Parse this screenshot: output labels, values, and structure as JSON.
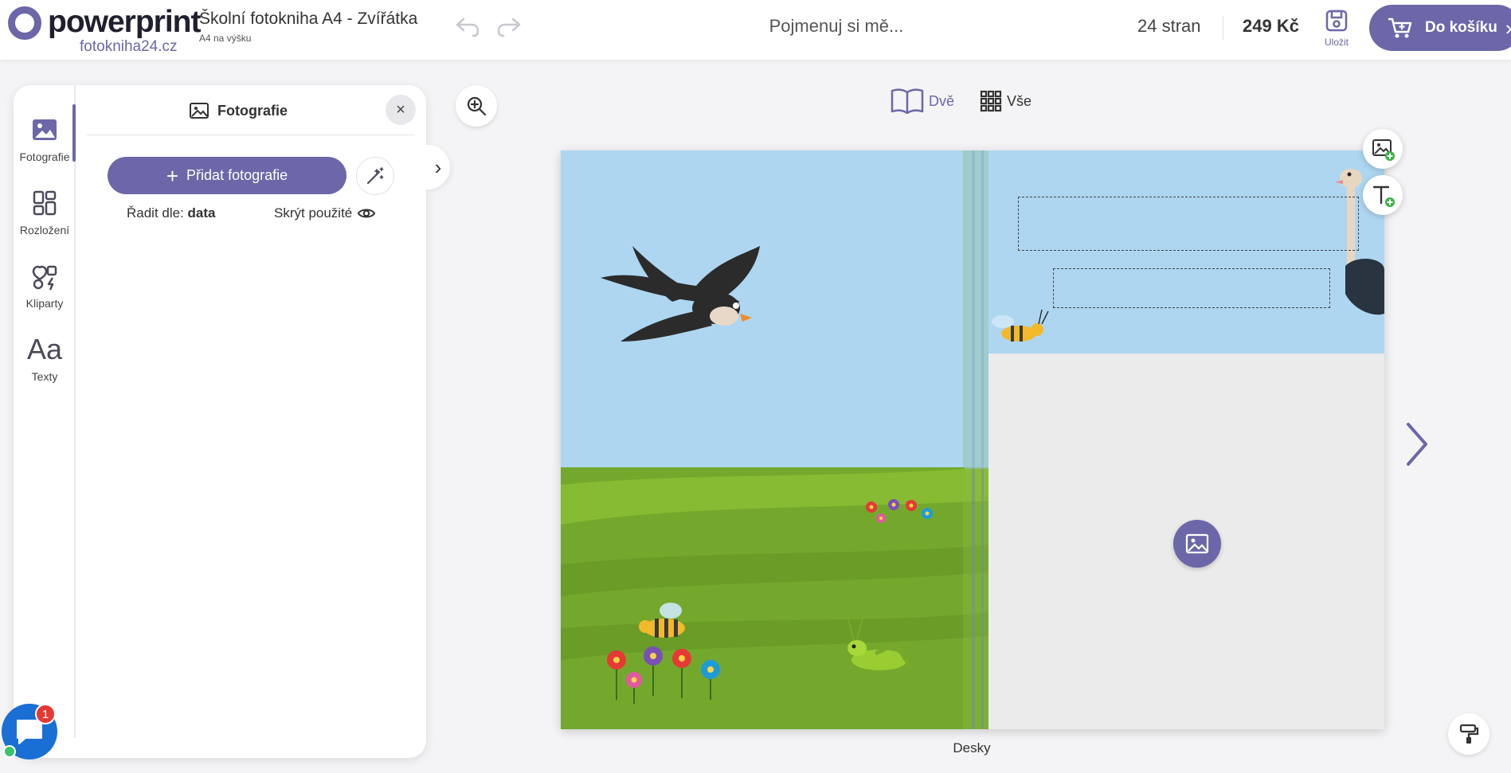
{
  "brand": {
    "name": "powerprint",
    "site": "fotokniha24.cz"
  },
  "project": {
    "title": "Školní fotokniha A4 - Zvířátka",
    "format": "A4 na výšku",
    "name_placeholder": "Pojmenuj si mě..."
  },
  "header": {
    "pages": "24 stran",
    "price": "249 Kč",
    "save_label": "Uložit",
    "cart_label": "Do košíku"
  },
  "sidebar": {
    "items": [
      {
        "label": "Fotografie",
        "icon": "image-icon",
        "active": true
      },
      {
        "label": "Rozložení",
        "icon": "layout-icon",
        "active": false
      },
      {
        "label": "Kliparty",
        "icon": "clipart-icon",
        "active": false
      },
      {
        "label": "Texty",
        "icon": "text-aa-icon",
        "glyph": "Aa",
        "active": false
      }
    ]
  },
  "panel": {
    "title": "Fotografie",
    "add_button": "Přidat fotografie",
    "sort_prefix": "Řadit dle: ",
    "sort_value": "data",
    "hide_used": "Skrýt použité"
  },
  "view": {
    "two_label": "Dvě",
    "all_label": "Vše",
    "active": "two"
  },
  "spread": {
    "label": "Desky"
  },
  "chat": {
    "badge": "1"
  },
  "colors": {
    "accent": "#6b67a8",
    "sky": "#aed6f1",
    "grass": "#74a82d",
    "placeholder_bg": "#ebebeb"
  }
}
